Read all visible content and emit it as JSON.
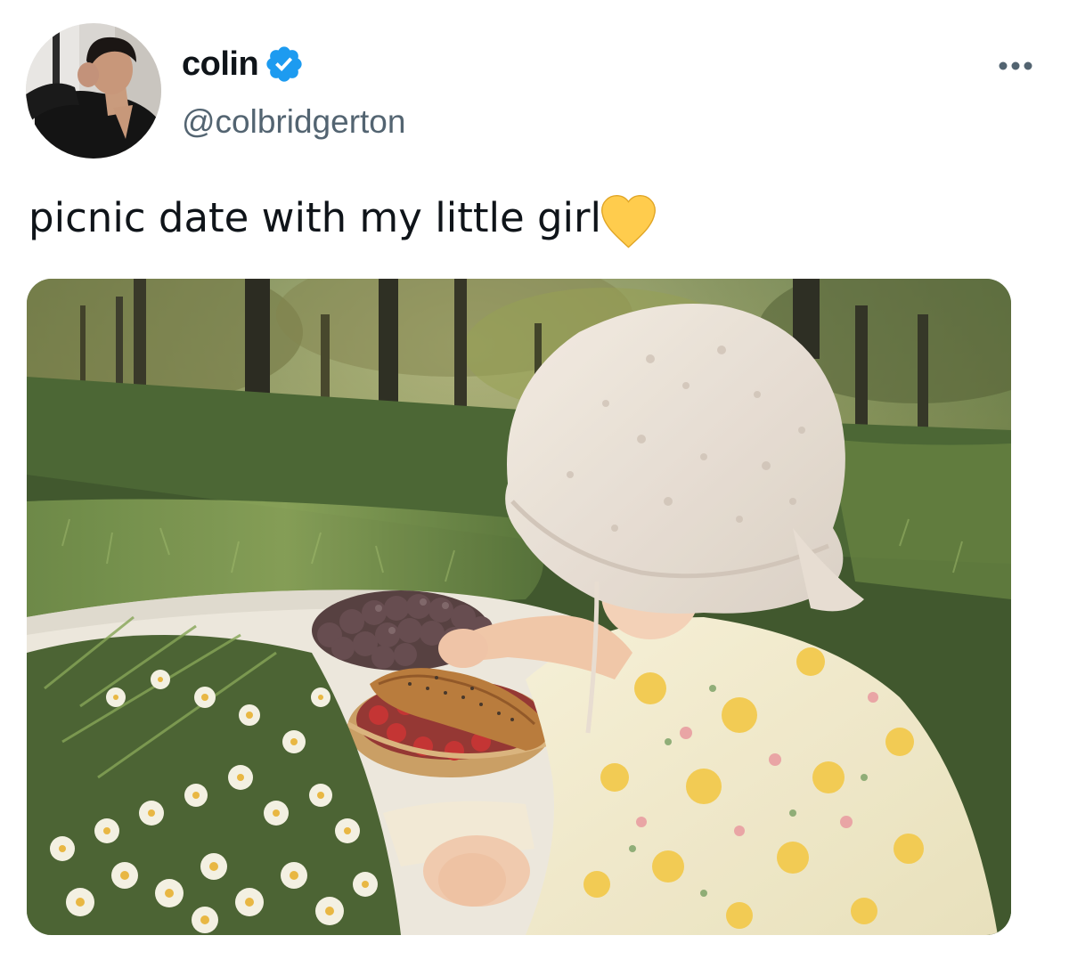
{
  "author": {
    "display_name": "colin",
    "handle": "@colbridgerton",
    "verified": true,
    "avatar_icon": "profile-photo"
  },
  "tweet": {
    "text": "picnic date with my little girl",
    "emoji": "yellow-heart",
    "media_icon": "photo-baby-picnic"
  },
  "actions": {
    "more_icon": "more-horizontal-icon"
  },
  "colors": {
    "verified_blue": "#1d9bf0",
    "handle_gray": "#536471",
    "text": "#0f1419",
    "heart_yellow": "#ffcc4d"
  }
}
